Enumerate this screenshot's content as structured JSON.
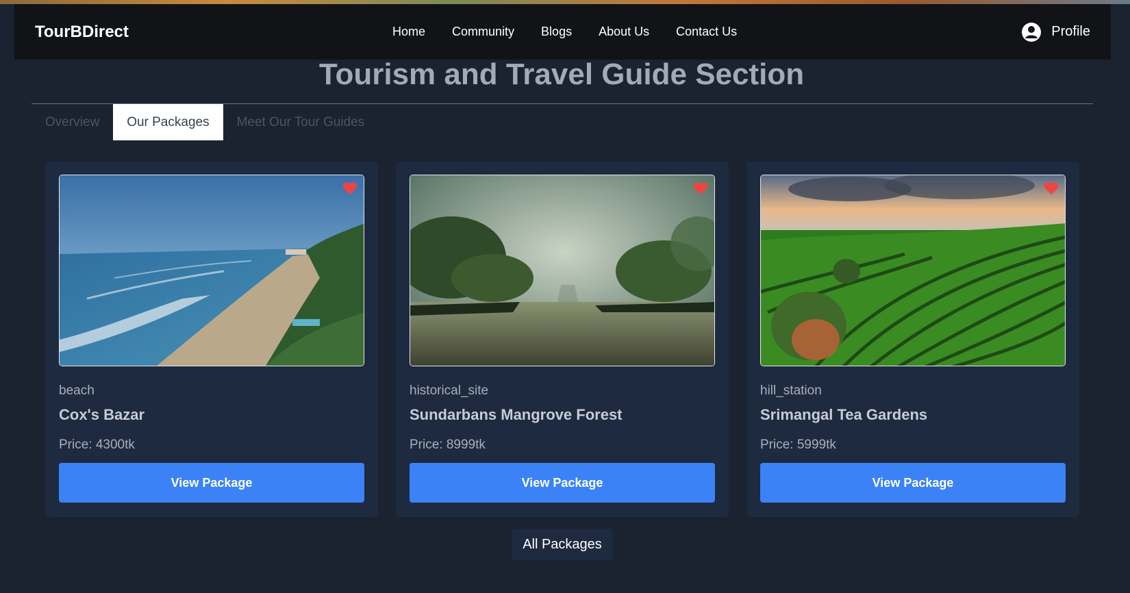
{
  "nav": {
    "brand": "TourBDirect",
    "links": [
      "Home",
      "Community",
      "Blogs",
      "About Us",
      "Contact Us"
    ],
    "profile_label": "Profile",
    "profile_icon": "user-circle-icon"
  },
  "section": {
    "title": "Tourism and Travel Guide Section"
  },
  "tabs": [
    {
      "label": "Overview",
      "active": false
    },
    {
      "label": "Our Packages",
      "active": true
    },
    {
      "label": "Meet Our Tour Guides",
      "active": false
    }
  ],
  "packages": [
    {
      "category": "beach",
      "title": "Cox's Bazar",
      "price": "Price: 4300tk",
      "button": "View Package",
      "image": "beach-coastline-image",
      "favorite_icon": "heart-icon"
    },
    {
      "category": "historical_site",
      "title": "Sundarbans Mangrove Forest",
      "price": "Price: 8999tk",
      "button": "View Package",
      "image": "mangrove-forest-image",
      "favorite_icon": "heart-icon"
    },
    {
      "category": "hill_station",
      "title": "Srimangal Tea Gardens",
      "price": "Price: 5999tk",
      "button": "View Package",
      "image": "tea-garden-image",
      "favorite_icon": "heart-icon"
    }
  ],
  "all_packages_label": "All Packages",
  "colors": {
    "background": "#1b2230",
    "navbar": "#111317",
    "card": "#1e2a40",
    "button": "#3b82f6",
    "heart": "#ef4444"
  }
}
